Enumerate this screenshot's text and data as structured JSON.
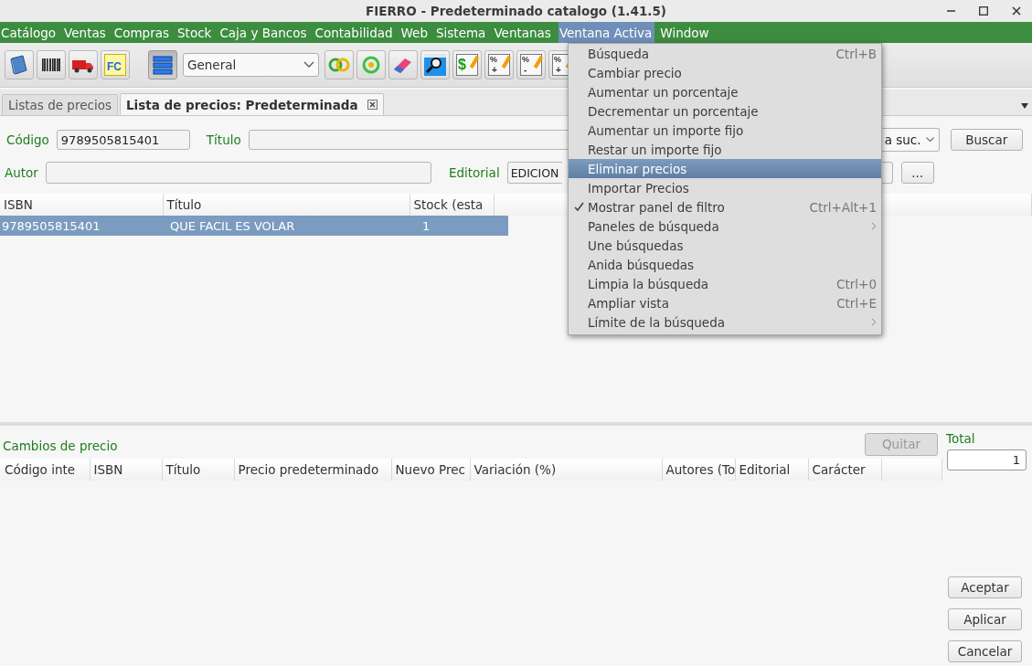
{
  "window": {
    "title": "FIERRO - Predeterminado catalogo (1.41.5)"
  },
  "menu_bar": [
    {
      "label": "Catálogo",
      "selected": false
    },
    {
      "label": "Ventas",
      "selected": false
    },
    {
      "label": "Compras",
      "selected": false
    },
    {
      "label": "Stock",
      "selected": false
    },
    {
      "label": "Caja y Bancos",
      "selected": false
    },
    {
      "label": "Contabilidad",
      "selected": false
    },
    {
      "label": "Web",
      "selected": false
    },
    {
      "label": "Sistema",
      "selected": false
    },
    {
      "label": "Ventanas",
      "selected": false
    },
    {
      "label": "Ventana Activa",
      "selected": true
    },
    {
      "label": "Window",
      "selected": false
    }
  ],
  "toolbar": {
    "left_buttons": [
      {
        "kind": "book"
      },
      {
        "kind": "barcode"
      },
      {
        "kind": "truck"
      },
      {
        "kind": "document",
        "glyph": "FC"
      }
    ],
    "view_toggle": {
      "on": true
    },
    "combo": {
      "value": "General"
    },
    "right_buttons": [
      {
        "kind": "rings"
      },
      {
        "kind": "target"
      },
      {
        "kind": "eraser"
      },
      {
        "kind": "magnifier"
      },
      {
        "kind": "price",
        "glyph": "$"
      },
      {
        "kind": "percent",
        "glyph": "%",
        "sign": "+"
      },
      {
        "kind": "percent",
        "glyph": "%",
        "sign": "-"
      },
      {
        "kind": "percent",
        "glyph": "%",
        "sign": "+"
      }
    ]
  },
  "tabs": [
    {
      "label": "Listas de precios",
      "selected": false,
      "closable": false
    },
    {
      "label": "Lista de precios: Predeterminada",
      "selected": true,
      "closable": true
    }
  ],
  "filter": {
    "codigo": {
      "label": "Código",
      "value": "9789505815401"
    },
    "titulo": {
      "label": "Título"
    },
    "branch_select": {
      "value": "a suc."
    },
    "search_button": "Buscar",
    "autor": {
      "label": "Autor"
    },
    "editorial": {
      "label": "Editorial",
      "value": "EDICION"
    },
    "browse_button": "..."
  },
  "results": {
    "columns": [
      "ISBN",
      "Título",
      "Stock (esta"
    ],
    "rows": [
      {
        "cells": [
          "9789505815401",
          "QUE FACIL ES VOLAR",
          "1"
        ],
        "selected": true
      }
    ]
  },
  "dropdown_menu": {
    "items": [
      {
        "label": "Búsqueda",
        "shortcut": "Ctrl+B",
        "selected": false,
        "checked": false,
        "submenu": false
      },
      {
        "label": "Cambiar precio",
        "selected": false,
        "checked": false,
        "submenu": false
      },
      {
        "label": "Aumentar un porcentaje",
        "selected": false,
        "checked": false,
        "submenu": false
      },
      {
        "label": "Decrementar un porcentaje",
        "selected": false,
        "checked": false,
        "submenu": false
      },
      {
        "label": "Aumentar un importe fijo",
        "selected": false,
        "checked": false,
        "submenu": false
      },
      {
        "label": "Restar un importe fijo",
        "selected": false,
        "checked": false,
        "submenu": false
      },
      {
        "label": "Eliminar precios",
        "selected": true,
        "checked": false,
        "submenu": false
      },
      {
        "label": "Importar Precios",
        "selected": false,
        "checked": false,
        "submenu": false
      },
      {
        "label": "Mostrar panel de filtro",
        "shortcut": "Ctrl+Alt+1",
        "selected": false,
        "checked": true,
        "submenu": false
      },
      {
        "label": "Paneles de búsqueda",
        "selected": false,
        "checked": false,
        "submenu": true
      },
      {
        "label": "Une búsquedas",
        "selected": false,
        "checked": false,
        "submenu": false
      },
      {
        "label": "Anida búsquedas",
        "selected": false,
        "checked": false,
        "submenu": false
      },
      {
        "label": "Limpia la búsqueda",
        "shortcut": "Ctrl+0",
        "selected": false,
        "checked": false,
        "submenu": false
      },
      {
        "label": "Ampliar vista",
        "shortcut": "Ctrl+E",
        "selected": false,
        "checked": false,
        "submenu": false
      },
      {
        "label": "Límite de la búsqueda",
        "selected": false,
        "checked": false,
        "submenu": true
      }
    ]
  },
  "price_changes": {
    "title": "Cambios de precio",
    "remove_button": {
      "label": "Quitar",
      "disabled": true
    },
    "columns": [
      "Código inte",
      "ISBN",
      "Título",
      "Precio predeterminado",
      "Nuevo Prec",
      "Variación (%)",
      "Autores (To",
      "Editorial",
      "Carácter"
    ],
    "total": {
      "label": "Total",
      "value": "1"
    }
  },
  "buttons": [
    "Aceptar",
    "Aplicar",
    "Cancelar"
  ]
}
